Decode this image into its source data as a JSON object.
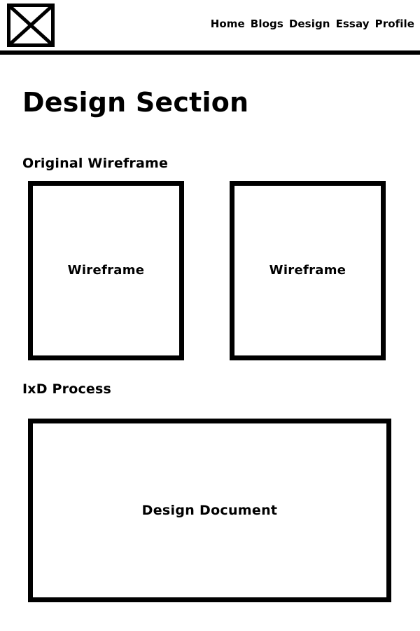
{
  "header": {
    "logo_icon": "image-placeholder-icon",
    "nav": [
      {
        "label": "Home"
      },
      {
        "label": "Blogs"
      },
      {
        "label": "Design"
      },
      {
        "label": "Essay"
      },
      {
        "label": "Profile"
      }
    ]
  },
  "main": {
    "page_title": "Design Section",
    "original_wireframe": {
      "heading": "Original Wireframe",
      "items": [
        {
          "label": "Wireframe"
        },
        {
          "label": "Wireframe"
        }
      ]
    },
    "ixd_process": {
      "heading": "IxD Process",
      "document_label": "Design Document"
    }
  },
  "colors": {
    "foreground": "#000000",
    "background": "#ffffff"
  }
}
